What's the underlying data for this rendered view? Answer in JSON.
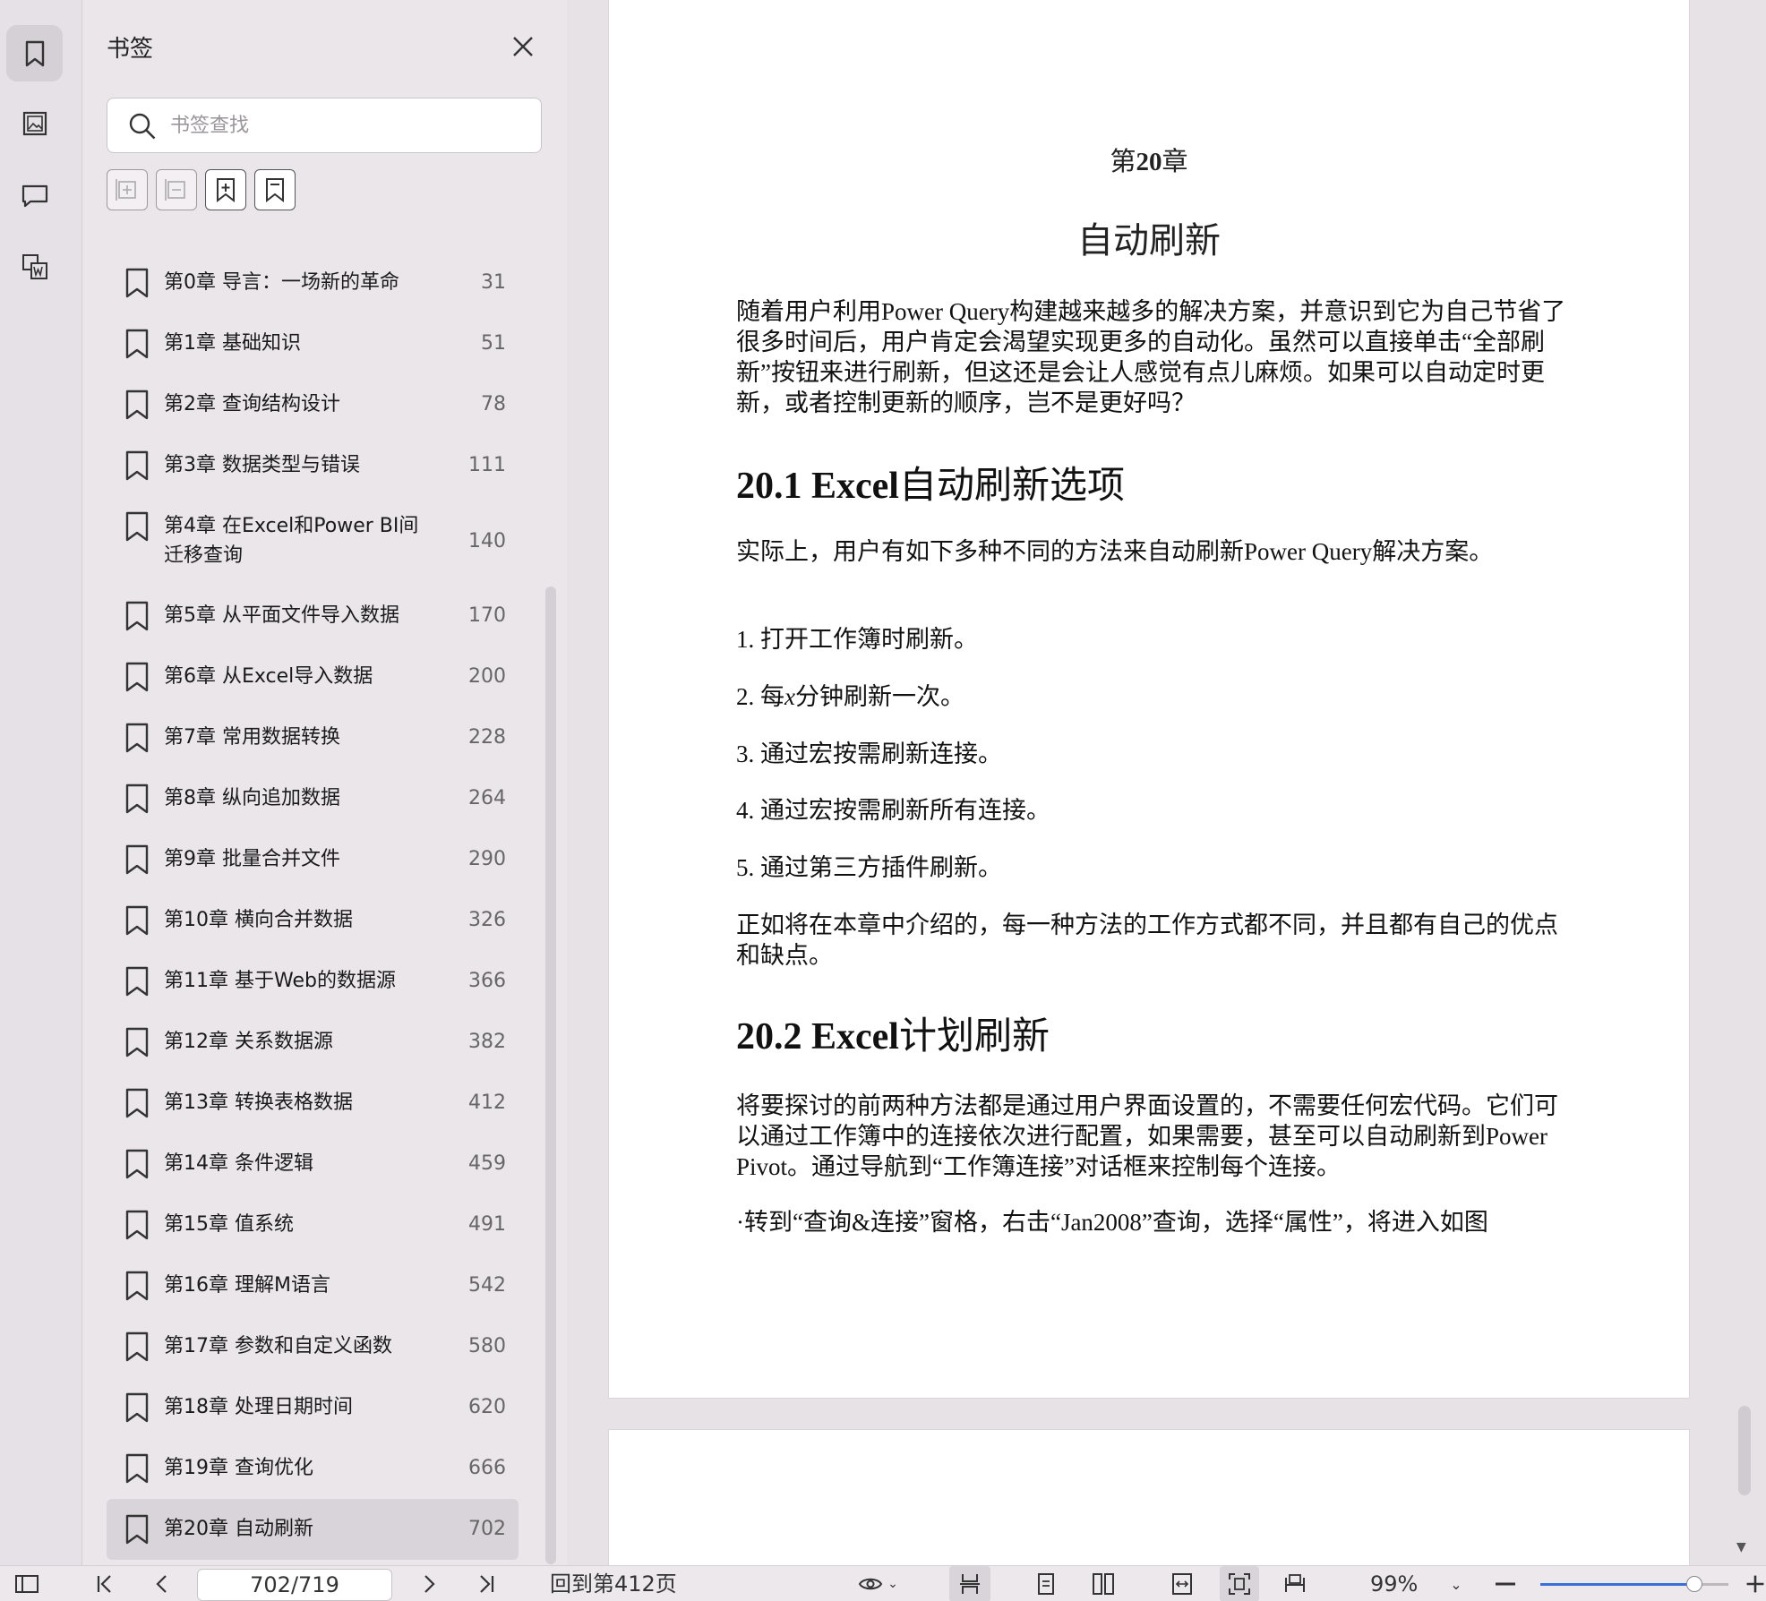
{
  "panel": {
    "title": "书签",
    "search_placeholder": "书签查找"
  },
  "bookmarks": [
    {
      "label": "第0章 导言：一场新的革命",
      "page": "31"
    },
    {
      "label": "第1章 基础知识",
      "page": "51"
    },
    {
      "label": "第2章 查询结构设计",
      "page": "78"
    },
    {
      "label": "第3章 数据类型与错误",
      "page": "111"
    },
    {
      "label": "第4章 在Excel和Power BI间迁移查询",
      "page": "140"
    },
    {
      "label": "第5章 从平面文件导入数据",
      "page": "170"
    },
    {
      "label": "第6章 从Excel导入数据",
      "page": "200"
    },
    {
      "label": "第7章 常用数据转换",
      "page": "228"
    },
    {
      "label": "第8章 纵向追加数据",
      "page": "264"
    },
    {
      "label": "第9章 批量合并文件",
      "page": "290"
    },
    {
      "label": "第10章 横向合并数据",
      "page": "326"
    },
    {
      "label": "第11章 基于Web的数据源",
      "page": "366"
    },
    {
      "label": "第12章 关系数据源",
      "page": "382"
    },
    {
      "label": "第13章 转换表格数据",
      "page": "412"
    },
    {
      "label": "第14章 条件逻辑",
      "page": "459"
    },
    {
      "label": "第15章 值系统",
      "page": "491"
    },
    {
      "label": "第16章 理解M语言",
      "page": "542"
    },
    {
      "label": "第17章 参数和自定义函数",
      "page": "580"
    },
    {
      "label": "第18章 处理日期时间",
      "page": "620"
    },
    {
      "label": "第19章 查询优化",
      "page": "666"
    },
    {
      "label": "第20章 自动刷新",
      "page": "702"
    }
  ],
  "document": {
    "chapter_prefix": "第",
    "chapter_number": "20",
    "chapter_suffix": "章",
    "chapter_title": "自动刷新",
    "intro": "随着用户利用Power Query构建越来越多的解决方案，并意识到它为自己节省了很多时间后，用户肯定会渴望实现更多的自动化。虽然可以直接单击“全部刷新”按钮来进行刷新，但这还是会让人感觉有点儿麻烦。如果可以自动定时更新，或者控制更新的顺序，岂不是更好吗？",
    "s1_num": "20.1 Excel",
    "s1_title": "自动刷新选项",
    "s1_p": "实际上，用户有如下多种不同的方法来自动刷新Power Query解决方案。",
    "item1": "1. 打开工作簿时刷新。",
    "item2_a": "2. 每",
    "item2_x": "x",
    "item2_b": "分钟刷新一次。",
    "item3": "3. 通过宏按需刷新连接。",
    "item4": "4. 通过宏按需刷新所有连接。",
    "item5": "5. 通过第三方插件刷新。",
    "s1_p2": "正如将在本章中介绍的，每一种方法的工作方式都不同，并且都有自己的优点和缺点。",
    "s2_num": "20.2 Excel",
    "s2_title": "计划刷新",
    "s2_p": "将要探讨的前两种方法都是通过用户界面设置的，不需要任何宏代码。它们可以通过工作簿中的连接依次进行配置，如果需要，甚至可以自动刷新到Power Pivot。通过导航到“工作簿连接”对话框来控制每个连接。",
    "s2_p2": "·转到“查询&连接”窗格，右击“Jan2008”查询，选择“属性”，将进入如图"
  },
  "statusbar": {
    "page_indicator": "702/719",
    "back_to_page": "回到第412页",
    "zoom": "99%",
    "zoom_level": 0.82
  },
  "colors": {
    "accent": "#3b6fd8"
  }
}
